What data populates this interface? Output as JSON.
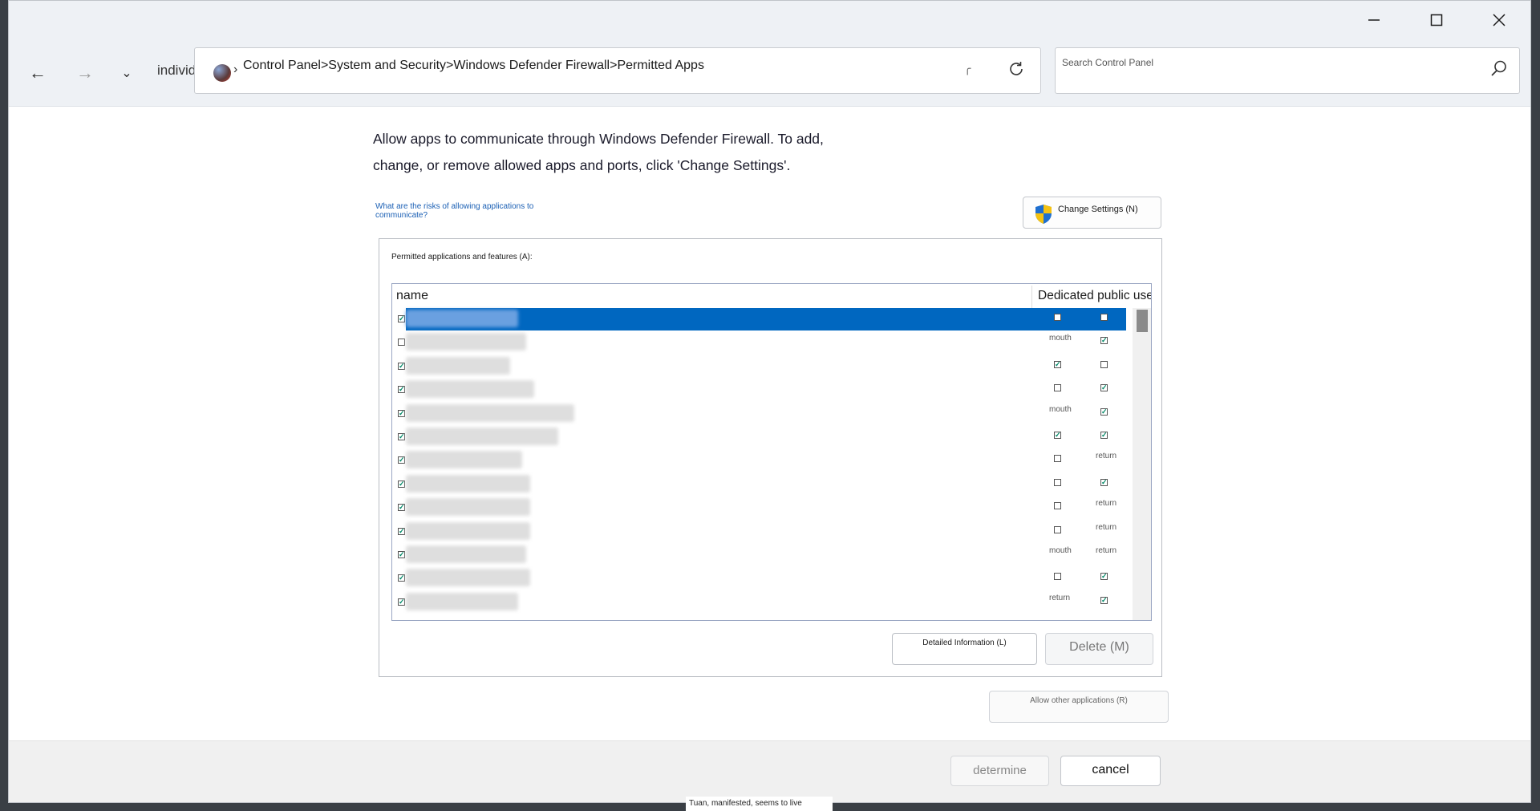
{
  "window": {
    "minimize_icon": "minimize-icon",
    "maximize_icon": "maximize-icon",
    "close_icon": "close-icon"
  },
  "nav": {
    "back_icon": "←",
    "forward_icon": "→",
    "recent_icon": "⌄",
    "crumb_prefix": "individual",
    "path_separator": "›",
    "path": "Control Panel>System and Security>Windows Defender Firewall>Permitted Apps",
    "search_placeholder": "Search Control Panel"
  },
  "main": {
    "intro": "Allow apps to communicate through Windows Defender Firewall. To add, change, or remove allowed apps and ports, click 'Change Settings'.",
    "risk_link": "What are the risks of allowing applications to communicate?",
    "change_settings": "Change Settings (N)",
    "group_title": "Permitted applications and features (A):",
    "col_name": "name",
    "col_public": "Dedicated public use",
    "rows": [
      {
        "checked": true,
        "dedicated": "box_off",
        "public": "box_off",
        "selected": true
      },
      {
        "checked": false,
        "dedicated": "mouth",
        "public": "box_on"
      },
      {
        "checked": true,
        "dedicated": "box_on",
        "public": "box_off"
      },
      {
        "checked": true,
        "dedicated": "box_off",
        "public": "box_on"
      },
      {
        "checked": true,
        "dedicated": "mouth",
        "public": "box_on"
      },
      {
        "checked": true,
        "dedicated": "box_on",
        "public": "box_on"
      },
      {
        "checked": true,
        "dedicated": "box_off",
        "public": "return"
      },
      {
        "checked": true,
        "dedicated": "box_off",
        "public": "box_on"
      },
      {
        "checked": true,
        "dedicated": "box_off",
        "public": "return"
      },
      {
        "checked": true,
        "dedicated": "box_off",
        "public": "return"
      },
      {
        "checked": true,
        "dedicated": "mouth",
        "public": "return"
      },
      {
        "checked": true,
        "dedicated": "box_off",
        "public": "box_on"
      },
      {
        "checked": true,
        "dedicated": "return",
        "public": "box_on"
      }
    ],
    "detail_button": "Detailed Information (L)",
    "delete_button": "Delete (M)",
    "allow_other_button": "Allow other applications (R)"
  },
  "footer": {
    "ok": "determine",
    "cancel": "cancel"
  },
  "tooltip": "Tuan, manifested, seems to live",
  "colors": {
    "selection": "#0067c0",
    "link": "#1a5fb4"
  }
}
